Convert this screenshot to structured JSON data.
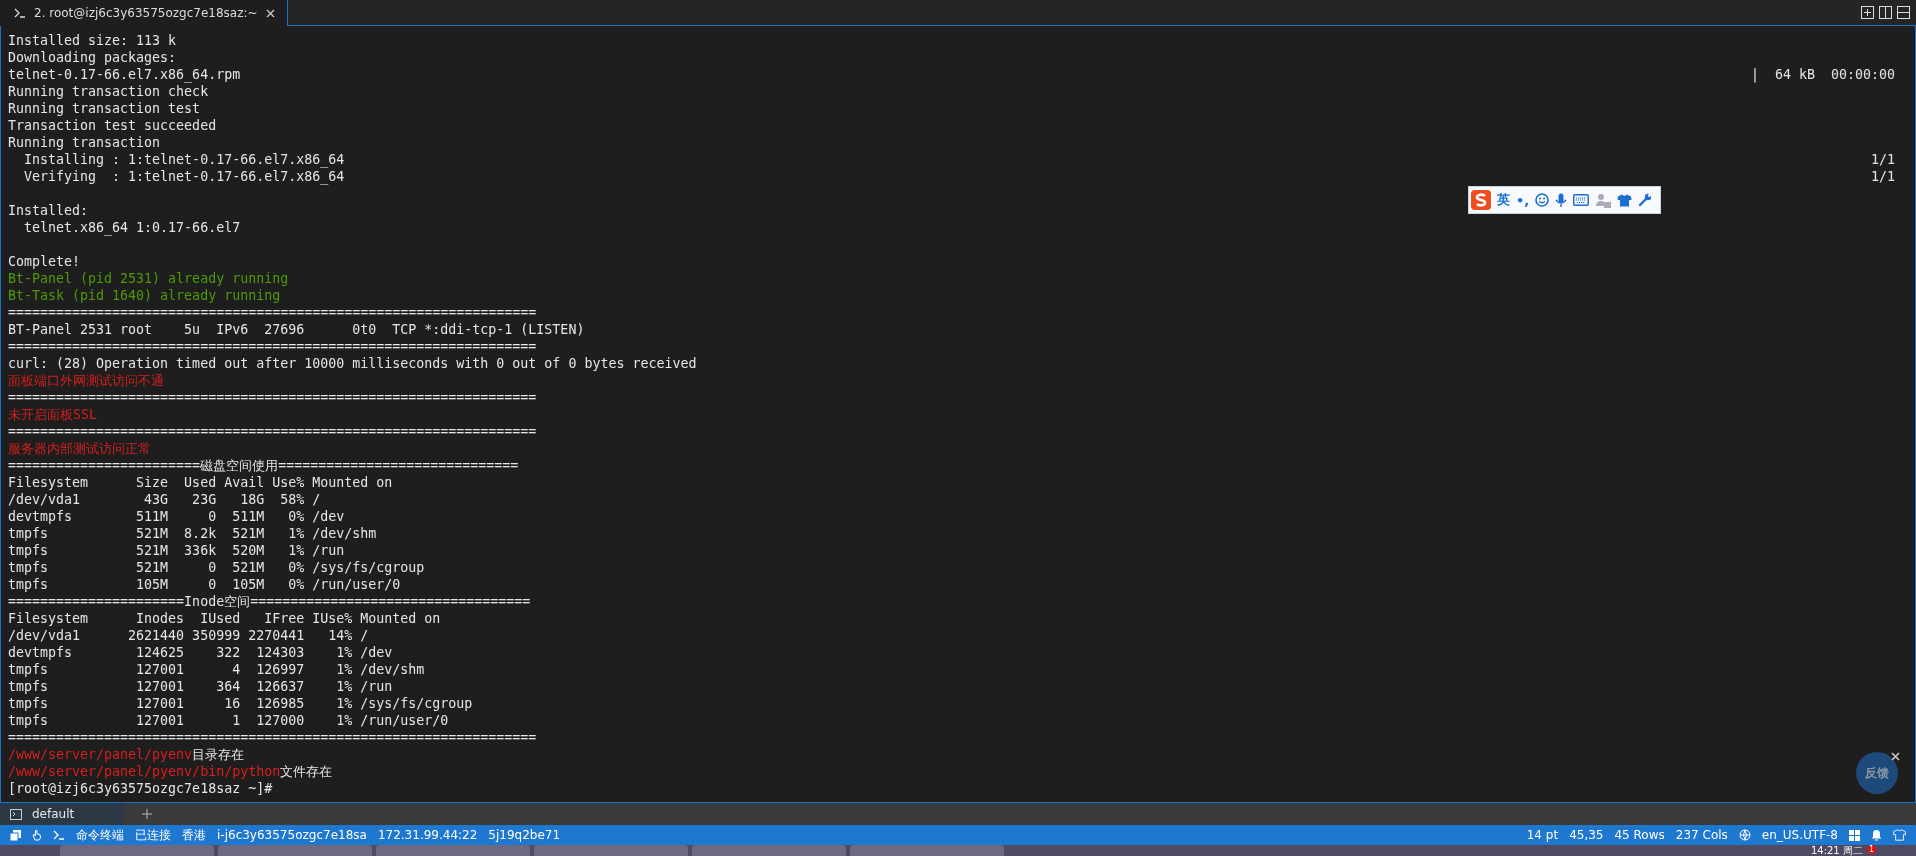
{
  "tabs": [
    {
      "label": "2. root@izj6c3y63575ozgc7e18saz:~",
      "selected": true
    }
  ],
  "terminal": {
    "lines": [
      {
        "segments": [
          {
            "text": "Installed size: 113 k",
            "kind": "plain"
          }
        ]
      },
      {
        "segments": [
          {
            "text": "Downloading packages:",
            "kind": "plain"
          }
        ]
      },
      {
        "segments": [
          {
            "text": "telnet-0.17-66.el7.x86_64.rpm",
            "kind": "plain"
          }
        ],
        "right": "|  64 kB  00:00:00"
      },
      {
        "segments": [
          {
            "text": "Running transaction check",
            "kind": "plain"
          }
        ]
      },
      {
        "segments": [
          {
            "text": "Running transaction test",
            "kind": "plain"
          }
        ]
      },
      {
        "segments": [
          {
            "text": "Transaction test succeeded",
            "kind": "plain"
          }
        ]
      },
      {
        "segments": [
          {
            "text": "Running transaction",
            "kind": "plain"
          }
        ]
      },
      {
        "segments": [
          {
            "text": "  Installing : 1:telnet-0.17-66.el7.x86_64",
            "kind": "plain"
          }
        ],
        "right": "1/1"
      },
      {
        "segments": [
          {
            "text": "  Verifying  : 1:telnet-0.17-66.el7.x86_64",
            "kind": "plain"
          }
        ],
        "right": "1/1"
      },
      {
        "segments": [
          {
            "text": "Installed:",
            "kind": "plain"
          }
        ],
        "space_before": true
      },
      {
        "segments": [
          {
            "text": "  telnet.x86_64 1:0.17-66.el7",
            "kind": "plain"
          }
        ]
      },
      {
        "segments": [
          {
            "text": "Complete!",
            "kind": "plain"
          }
        ],
        "space_before": true
      },
      {
        "segments": [
          {
            "text": "Bt-Panel (pid 2531) already running",
            "kind": "ok"
          }
        ]
      },
      {
        "segments": [
          {
            "text": "Bt-Task (pid 1640) already running",
            "kind": "ok"
          }
        ]
      },
      {
        "segments": [
          {
            "text": "==================================================================",
            "kind": "plain"
          }
        ]
      },
      {
        "segments": [
          {
            "text": "BT-Panel 2531 root    5u  IPv6  27696      0t0  TCP *:ddi-tcp-1 (LISTEN)",
            "kind": "plain"
          }
        ]
      },
      {
        "segments": [
          {
            "text": "==================================================================",
            "kind": "plain"
          }
        ]
      },
      {
        "segments": [
          {
            "text": "curl: (28) Operation timed out after 10000 milliseconds with 0 out of 0 bytes received",
            "kind": "plain"
          }
        ]
      },
      {
        "segments": [
          {
            "text": "面板端口外网测试访问不通",
            "kind": "error"
          }
        ]
      },
      {
        "segments": [
          {
            "text": "==================================================================",
            "kind": "plain"
          }
        ]
      },
      {
        "segments": [
          {
            "text": "未开启面板SSL",
            "kind": "error"
          }
        ]
      },
      {
        "segments": [
          {
            "text": "==================================================================",
            "kind": "plain"
          }
        ]
      },
      {
        "segments": [
          {
            "text": "服务器内部测试访问正常",
            "kind": "error"
          }
        ]
      },
      {
        "segments": [
          {
            "text": "========================磁盘空间使用==============================",
            "kind": "plain"
          }
        ]
      },
      {
        "segments": [
          {
            "text": "Filesystem      Size  Used Avail Use% Mounted on",
            "kind": "plain"
          }
        ]
      },
      {
        "segments": [
          {
            "text": "/dev/vda1        43G   23G   18G  58% /",
            "kind": "plain"
          }
        ]
      },
      {
        "segments": [
          {
            "text": "devtmpfs        511M     0  511M   0% /dev",
            "kind": "plain"
          }
        ]
      },
      {
        "segments": [
          {
            "text": "tmpfs           521M  8.2k  521M   1% /dev/shm",
            "kind": "plain"
          }
        ]
      },
      {
        "segments": [
          {
            "text": "tmpfs           521M  336k  520M   1% /run",
            "kind": "plain"
          }
        ]
      },
      {
        "segments": [
          {
            "text": "tmpfs           521M     0  521M   0% /sys/fs/cgroup",
            "kind": "plain"
          }
        ]
      },
      {
        "segments": [
          {
            "text": "tmpfs           105M     0  105M   0% /run/user/0",
            "kind": "plain"
          }
        ]
      },
      {
        "segments": [
          {
            "text": "======================Inode空间===================================",
            "kind": "plain"
          }
        ]
      },
      {
        "segments": [
          {
            "text": "Filesystem      Inodes  IUsed   IFree IUse% Mounted on",
            "kind": "plain"
          }
        ]
      },
      {
        "segments": [
          {
            "text": "/dev/vda1      2621440 350999 2270441   14% /",
            "kind": "plain"
          }
        ]
      },
      {
        "segments": [
          {
            "text": "devtmpfs        124625    322  124303    1% /dev",
            "kind": "plain"
          }
        ]
      },
      {
        "segments": [
          {
            "text": "tmpfs           127001      4  126997    1% /dev/shm",
            "kind": "plain"
          }
        ]
      },
      {
        "segments": [
          {
            "text": "tmpfs           127001    364  126637    1% /run",
            "kind": "plain"
          }
        ]
      },
      {
        "segments": [
          {
            "text": "tmpfs           127001     16  126985    1% /sys/fs/cgroup",
            "kind": "plain"
          }
        ]
      },
      {
        "segments": [
          {
            "text": "tmpfs           127001      1  127000    1% /run/user/0",
            "kind": "plain"
          }
        ]
      },
      {
        "segments": [
          {
            "text": "==================================================================",
            "kind": "plain"
          }
        ]
      },
      {
        "segments": [
          {
            "text": "/www/server/panel/pyenv",
            "kind": "error"
          },
          {
            "text": "目录存在",
            "kind": "plain"
          }
        ]
      },
      {
        "segments": [
          {
            "text": "/www/server/panel/pyenv/bin/python",
            "kind": "error"
          },
          {
            "text": "文件存在",
            "kind": "plain"
          }
        ]
      },
      {
        "segments": [
          {
            "text": "[root@izj6c3y63575ozgc7e18saz ~]#",
            "kind": "plain"
          }
        ]
      }
    ]
  },
  "ime_toolbar": {
    "mode": "英",
    "punctuation": "•,"
  },
  "feedback": {
    "label": "反馈"
  },
  "session_tabs": [
    {
      "label": "default",
      "selected": true
    }
  ],
  "status_bar": {
    "left": [
      {
        "text": "命令终端",
        "kind": "terminal"
      },
      {
        "text": "已连接"
      },
      {
        "text": "香港"
      },
      {
        "text": "i-j6c3y63575ozgc7e18sa"
      },
      {
        "text": "172.31.99.44:22"
      },
      {
        "text": "5j19q2be71"
      }
    ],
    "right": [
      {
        "text": "14 pt"
      },
      {
        "text": "45,35"
      },
      {
        "text": "45 Rows"
      },
      {
        "text": "237 Cols"
      },
      {
        "text": "en_US.UTF-8",
        "kind": "locale"
      }
    ]
  },
  "taskbar": {
    "clock": "14:21 周二",
    "badge": "1"
  }
}
